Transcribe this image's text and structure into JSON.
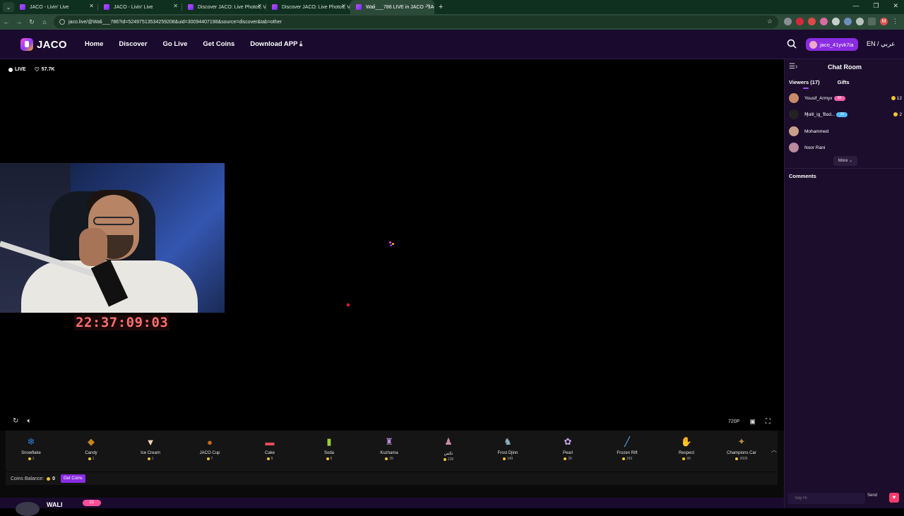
{
  "browser": {
    "tabs": [
      {
        "title": "JACO - Livin' Live",
        "active": false
      },
      {
        "title": "JACO - Livin' Live",
        "active": false
      },
      {
        "title": "Discover JACO: Live Photos, Vi",
        "active": false
      },
      {
        "title": "Discover JACO: Live Photos, Vi",
        "active": false
      },
      {
        "title": "Wali___786 LIVE in JACO - JACO",
        "active": true
      }
    ],
    "url": "jaco.live/@Wali___786?id=52497513534259208&uid=30094407198&source=discover&tab=other",
    "profile_initial": "M"
  },
  "site": {
    "logo": "JACO",
    "nav": [
      "Home",
      "Discover",
      "Go Live",
      "Get Coins",
      "Download APP"
    ],
    "user": "jaco_41yvk7ia",
    "lang": "EN / عربي"
  },
  "player": {
    "live_label": "LIVE",
    "likes": "57.7K",
    "timer": "22:37:09:03",
    "quality": "720P"
  },
  "gifts": [
    {
      "name": "Snowflake",
      "price": "1",
      "icon": "snowflake-icon",
      "color": "#2a7fd4",
      "glyph": "❄"
    },
    {
      "name": "Candy",
      "price": "1",
      "icon": "candy-icon",
      "color": "#c8831e",
      "glyph": "◆"
    },
    {
      "name": "Ice Cream",
      "price": "1",
      "icon": "ice-cream-icon",
      "color": "#f1d6b8",
      "glyph": "▼"
    },
    {
      "name": "JACO Cup",
      "price": "7",
      "icon": "jaco-cup-icon",
      "color": "#c76a16",
      "glyph": "●"
    },
    {
      "name": "Cake",
      "price": "9",
      "icon": "cake-icon",
      "color": "#e94b5e",
      "glyph": "▬"
    },
    {
      "name": "Soda",
      "price": "6",
      "icon": "soda-icon",
      "color": "#9ccf3a",
      "glyph": "▮"
    },
    {
      "name": "Kuzhama",
      "price": "39",
      "icon": "kuzhama-icon",
      "color": "#b58bd9",
      "glyph": "♜"
    },
    {
      "name": "تكس",
      "price": "239",
      "icon": "dancer-icon",
      "color": "#c98aa8",
      "glyph": "♟"
    },
    {
      "name": "Frost Djinn",
      "price": "149",
      "icon": "frost-djinn-icon",
      "color": "#8fb4c9",
      "glyph": "♞"
    },
    {
      "name": "Pearl",
      "price": "39",
      "icon": "pearl-icon",
      "color": "#c9a6ef",
      "glyph": "✿"
    },
    {
      "name": "Frozen Rift",
      "price": "169",
      "icon": "frozen-rift-icon",
      "color": "#5fb3f0",
      "glyph": "╱"
    },
    {
      "name": "Respect",
      "price": "99",
      "icon": "respect-icon",
      "color": "#4a3a2a",
      "glyph": "✋"
    },
    {
      "name": "Champions Car",
      "price": "2005",
      "icon": "champions-car-icon",
      "color": "#b88a3a",
      "glyph": "✦"
    }
  ],
  "balance": {
    "label": "Coins Balance:",
    "value": "0",
    "get_coins": "Get Coins"
  },
  "streamer": {
    "name": "WALI",
    "level": "21"
  },
  "chat": {
    "title": "Chat Room",
    "tab_viewers": "Viewers (17)",
    "tab_gifts": "Gifts",
    "viewers": [
      {
        "name": "Yousif_Armyx",
        "badge": "30",
        "badge_color": "#ff5fa8",
        "coins": "12",
        "avatar_color": "#c78a6a"
      },
      {
        "name": "Ɱɑlil_ig_Ɓɑd...",
        "badge": "20",
        "badge_color": "#4fb8ff",
        "coins": "2",
        "avatar_color": "#222"
      },
      {
        "name": "Mohammed",
        "badge": "",
        "badge_color": "",
        "coins": "",
        "avatar_color": "#c9a08a"
      },
      {
        "name": "Noor Rani",
        "badge": "",
        "badge_color": "",
        "coins": "",
        "avatar_color": "#b98aa0"
      }
    ],
    "more": "More",
    "comments_title": "Comments",
    "input_placeholder": "Say Hi",
    "send": "Send"
  }
}
